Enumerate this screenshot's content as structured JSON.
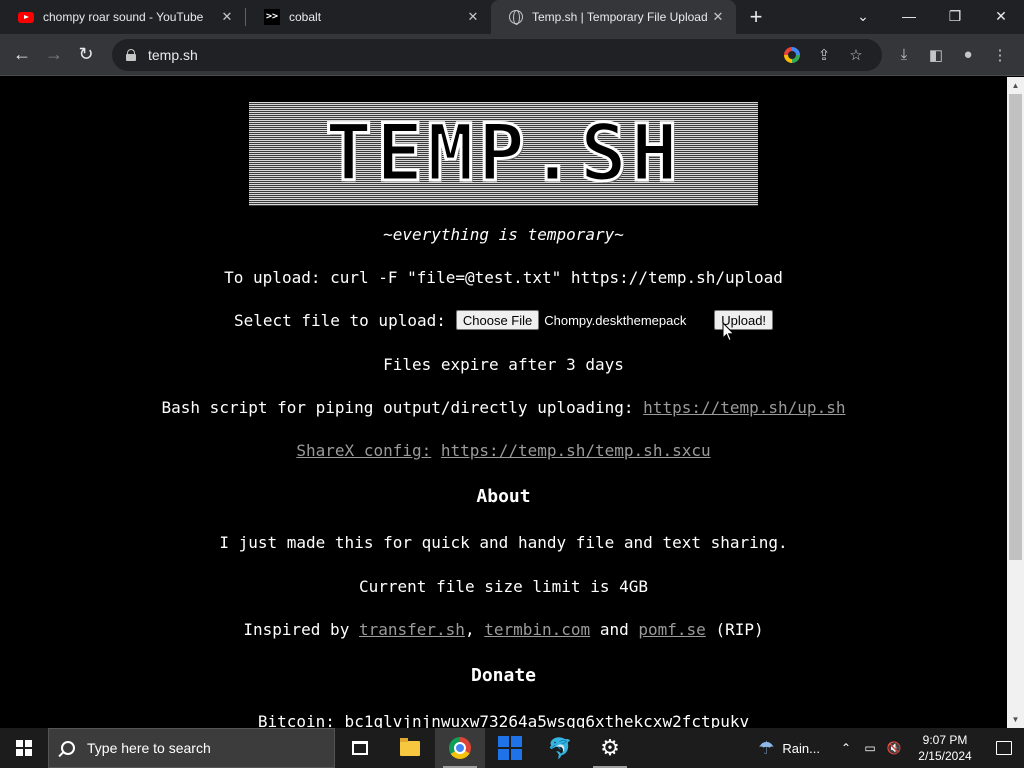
{
  "browser": {
    "tabs": [
      {
        "title": "chompy roar sound - YouTube",
        "favicon": "youtube-icon",
        "active": false
      },
      {
        "title": "cobalt",
        "favicon": "cobalt-icon",
        "active": false
      },
      {
        "title": "Temp.sh | Temporary File Upload",
        "favicon": "globe-icon",
        "active": true
      }
    ],
    "new_tab": "+",
    "url": "temp.sh"
  },
  "page": {
    "logo_text": "TEMP.SH",
    "tagline": "~everything is temporary~",
    "upload_cmd": "To upload: curl -F \"file=@test.txt\" https://temp.sh/upload",
    "select_label": "Select file to upload:",
    "choose_file": "Choose File",
    "file_name": "Chompy.deskthemepack",
    "upload_button": "Upload!",
    "expire": "Files expire after 3 days",
    "bash_label": "Bash script for piping output/directly uploading:",
    "bash_link": "https://temp.sh/up.sh",
    "sharex_label": "ShareX config:",
    "sharex_link": "https://temp.sh/temp.sh.sxcu",
    "about_heading": "About",
    "about_text": "I just made this for quick and handy file and text sharing.",
    "limit_text": "Current file size limit is 4GB",
    "inspired_prefix": "Inspired by",
    "inspired_links": [
      "transfer.sh",
      "termbin.com",
      "pomf.se"
    ],
    "inspired_sep1": ",",
    "inspired_and": "and",
    "inspired_suffix": "(RIP)",
    "donate_heading": "Donate",
    "bitcoin": "Bitcoin: bc1qlvjnjnwuxw73264a5wsqq6xthekcxw2fctpukv"
  },
  "taskbar": {
    "search_placeholder": "Type here to search",
    "weather": "Rain...",
    "time": "9:07 PM",
    "date": "2/15/2024"
  },
  "colors": {
    "link": "#9a9a9a",
    "tab_active": "#35363a",
    "tabstrip": "#202124"
  }
}
